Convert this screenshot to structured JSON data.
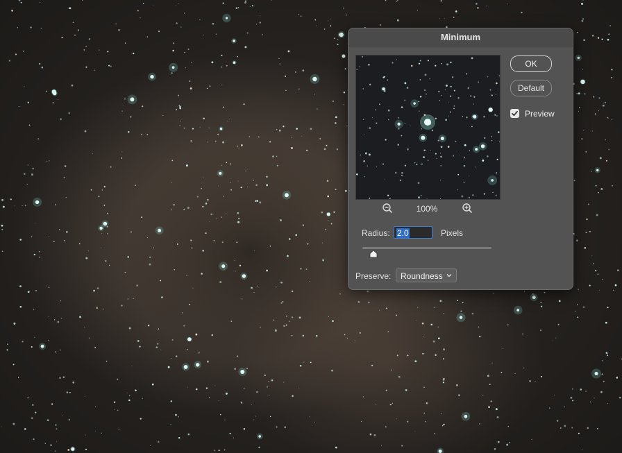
{
  "dialog": {
    "title": "Minimum",
    "ok_label": "OK",
    "default_label": "Default",
    "preview_label": "Preview",
    "preview_checked": true,
    "zoom_level": "100%",
    "radius_label": "Radius:",
    "radius_value": "2.0",
    "radius_unit": "Pixels",
    "preserve_label": "Preserve:",
    "preserve_value": "Roundness"
  },
  "icons": {
    "zoom_out": "zoom-out-icon",
    "zoom_in": "zoom-in-icon",
    "checkmark": "checkmark-icon",
    "chevron": "chevron-down-icon",
    "slider_thumb": "slider-thumb-icon"
  },
  "colors": {
    "dialog_bg": "#535353",
    "input_focus": "#3e7fd6",
    "star": "#bfe9e6"
  }
}
